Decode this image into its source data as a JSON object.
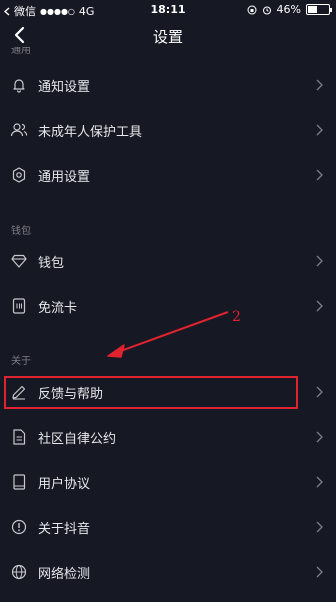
{
  "status": {
    "carrier": "微信",
    "network": "4G",
    "time": "18:11",
    "battery": "46%",
    "battery_level": 0.46
  },
  "nav": {
    "title": "设置"
  },
  "sections": {
    "general_partial": "通用",
    "wallet": "钱包",
    "about": "关于"
  },
  "rows": [
    {
      "label": "通知设置",
      "icon": "bell-icon"
    },
    {
      "label": "未成年人保护工具",
      "icon": "people-icon"
    },
    {
      "label": "通用设置",
      "icon": "gear-icon"
    },
    {
      "label": "钱包",
      "icon": "diamond-icon"
    },
    {
      "label": "免流卡",
      "icon": "sim-card-icon"
    },
    {
      "label": "反馈与帮助",
      "icon": "pencil-icon"
    },
    {
      "label": "社区自律公约",
      "icon": "document-icon"
    },
    {
      "label": "用户协议",
      "icon": "book-icon"
    },
    {
      "label": "关于抖音",
      "icon": "info-icon"
    },
    {
      "label": "网络检测",
      "icon": "globe-icon"
    }
  ],
  "annotation": {
    "number": "2",
    "color": "#e0232e"
  }
}
